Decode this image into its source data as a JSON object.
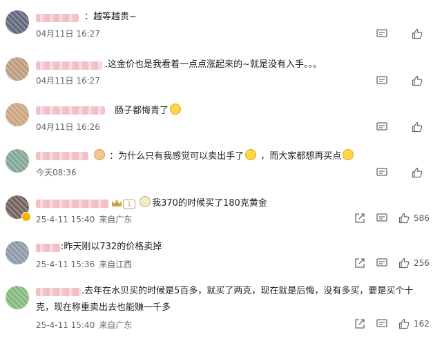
{
  "comments": [
    {
      "text": "：越等越贵~",
      "time": "04月11日 16:27",
      "location": ""
    },
    {
      "text": ".这金价也是我看着一点点涨起来的~就是没有入手。。。",
      "time": "04月11日 16:27",
      "location": ""
    },
    {
      "text": "肠子都悔青了",
      "time": "04月11日 16:26",
      "location": ""
    },
    {
      "text_a": "：为什么只有我感觉可以卖出手了",
      "text_b": "，而大家都想再买点",
      "time": "今天08:36",
      "location": ""
    },
    {
      "text": "我370的时候买了180克黄金",
      "time": "25-4-11 15:40",
      "location": "来自广东",
      "likes": "586",
      "level": "1"
    },
    {
      "text": ":昨天刚以732的价格卖掉",
      "time": "25-4-11 15:36",
      "location": "来自江西",
      "likes": "256"
    },
    {
      "text_line1": ".去年在水贝买的时候是5百多，就买了两克，现在就是后悔，没有多买，要是买个十",
      "text_line2": "克，现在称重卖出去也能赚一千多",
      "time": "25-4-11 15:40",
      "location": "来自广东",
      "likes": "162"
    }
  ],
  "icons": {
    "comment": "comment-icon",
    "like": "thumbs-up-icon",
    "share": "share-icon"
  },
  "colors": {
    "meta": "#666666",
    "text": "#222222",
    "name_blur": "#f2b6bf",
    "badge": "#f5b400"
  }
}
